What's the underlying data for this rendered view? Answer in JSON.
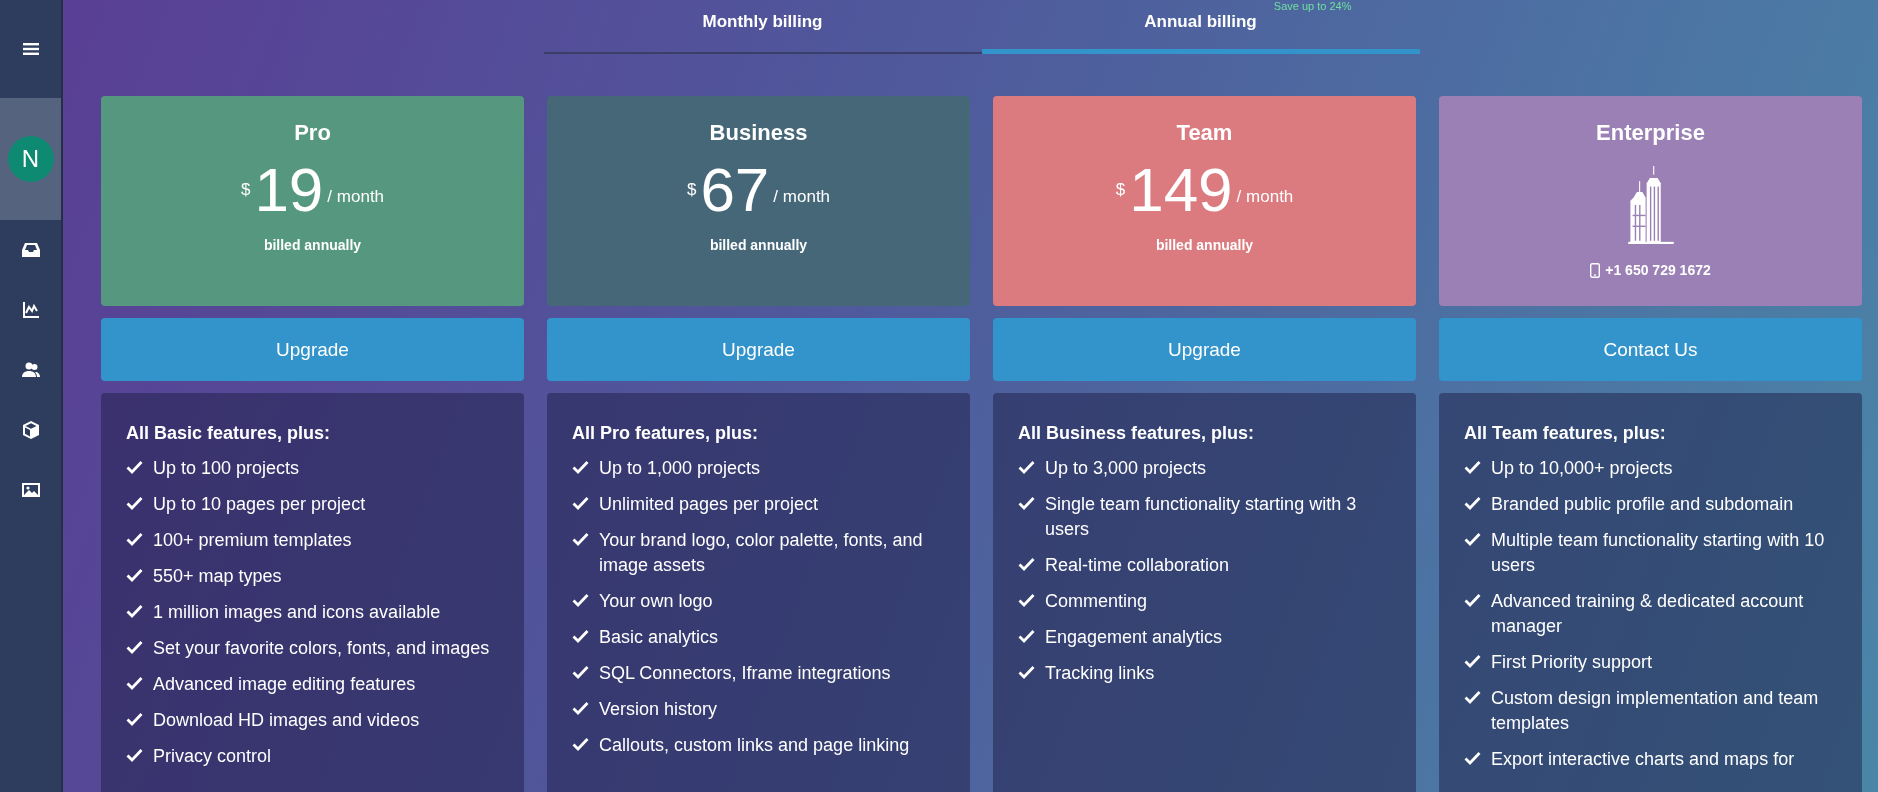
{
  "sidebar": {
    "items": [
      {
        "kind": "menu",
        "selected": false
      },
      {
        "kind": "avatar",
        "label": "N",
        "selected": true
      },
      {
        "kind": "inbox",
        "selected": false
      },
      {
        "kind": "chart",
        "selected": false
      },
      {
        "kind": "users",
        "selected": false
      },
      {
        "kind": "cube",
        "selected": false
      },
      {
        "kind": "image",
        "selected": false
      }
    ]
  },
  "tabs": [
    {
      "label": "Monthly billing",
      "selected": false
    },
    {
      "label": "Annual billing",
      "selected": true,
      "badge": "Save up to 24%"
    }
  ],
  "plans": [
    {
      "kind": "price",
      "name": "Pro",
      "color": "#56977f",
      "currency": "$",
      "price": "19",
      "period": "/ month",
      "note": "billed annually",
      "button": "Upgrade",
      "features_heading": "All Basic features, plus:",
      "features": [
        "Up to 100 projects",
        "Up to 10 pages per project",
        "100+ premium templates",
        "550+ map types",
        "1 million images and icons available",
        "Set your favorite colors, fonts, and images",
        "Advanced image editing features",
        "Download HD images and videos",
        "Privacy control"
      ]
    },
    {
      "kind": "price",
      "name": "Business",
      "color": "#466778",
      "currency": "$",
      "price": "67",
      "period": "/ month",
      "note": "billed annually",
      "button": "Upgrade",
      "features_heading": "All Pro features, plus:",
      "features": [
        "Up to 1,000 projects",
        "Unlimited pages per project",
        "Your brand logo, color palette, fonts, and image assets",
        "Your own logo",
        "Basic analytics",
        "SQL Connectors, Iframe integrations",
        "Version history",
        "Callouts, custom links and page linking"
      ]
    },
    {
      "kind": "price",
      "name": "Team",
      "color": "#db7b7f",
      "currency": "$",
      "price": "149",
      "period": "/ month",
      "note": "billed annually",
      "button": "Upgrade",
      "features_heading": "All Business features, plus:",
      "features": [
        "Up to 3,000 projects",
        "Single team functionality starting with 3 users",
        "Real-time collaboration",
        "Commenting",
        "Engagement analytics",
        "Tracking links"
      ]
    },
    {
      "kind": "contact",
      "name": "Enterprise",
      "color": "#9b80b5",
      "phone": "+1 650 729 1672",
      "button": "Contact Us",
      "features_heading": "All Team features, plus:",
      "features": [
        "Up to 10,000+ projects",
        "Branded public profile and subdomain",
        "Multiple team functionality starting with 10 users",
        "Advanced training & dedicated account manager",
        "First Priority support",
        "Custom design implementation and team templates",
        "Export interactive charts and maps for"
      ]
    }
  ]
}
